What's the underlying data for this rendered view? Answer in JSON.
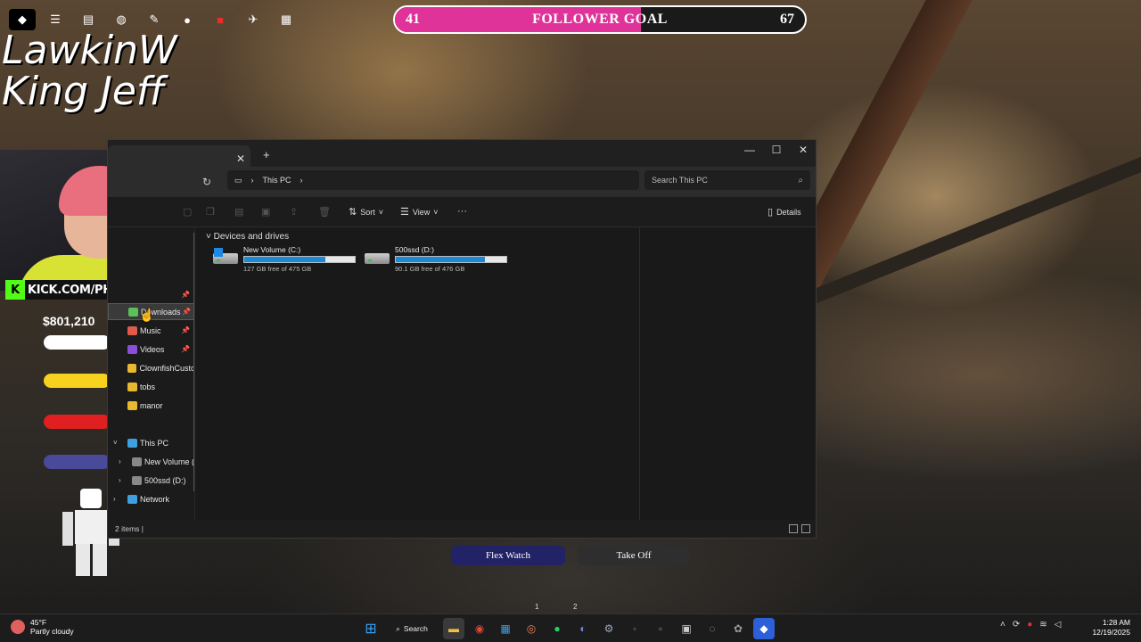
{
  "overlay": {
    "top_icons": [
      {
        "icon": "kick-icon",
        "glyph": "◆"
      },
      {
        "icon": "menu-icon",
        "glyph": "☰"
      },
      {
        "icon": "chat-icon",
        "glyph": "▤"
      },
      {
        "icon": "globe-icon",
        "glyph": "◍"
      },
      {
        "icon": "user-edit-icon",
        "glyph": "✎"
      },
      {
        "icon": "user-icon",
        "glyph": "●"
      },
      {
        "icon": "stop-icon",
        "glyph": "■"
      },
      {
        "icon": "runner-icon",
        "glyph": "✈"
      },
      {
        "icon": "grid-icon",
        "glyph": "▦"
      }
    ],
    "goal": {
      "start": "41",
      "title": "FOLLOWER GOAL",
      "end": "67",
      "progress": 0.6
    },
    "names": [
      "LawkinW",
      "King Jeff"
    ],
    "kick_label": "KICK.COM/PHROPHET",
    "money": "$801,210",
    "stat_bars": [
      {
        "color": "#ffffff"
      },
      {
        "color": "#f6d21e"
      },
      {
        "color": "#e02020"
      },
      {
        "color": "#4a4a9a"
      }
    ]
  },
  "explorer": {
    "address": {
      "segments": [
        "This PC"
      ]
    },
    "search_placeholder": "Search This PC",
    "toolbar": {
      "sort": "Sort",
      "view": "View",
      "more": "···",
      "details": "Details"
    },
    "nav": [
      {
        "label": "Downloads",
        "icon_color": "#5ac05a",
        "pinned": true,
        "selected": true
      },
      {
        "label": "Music",
        "icon_color": "#e05a4e",
        "pinned": true
      },
      {
        "label": "Videos",
        "icon_color": "#8a4ed8",
        "pinned": true
      },
      {
        "label": "ClownfishCusto",
        "icon_color": "#e8b830"
      },
      {
        "label": "tobs",
        "icon_color": "#e8b830"
      },
      {
        "label": "manor",
        "icon_color": "#e8b830"
      }
    ],
    "tree": {
      "this_pc": "This PC",
      "children": [
        "New Volume (",
        "500ssd (D:)"
      ],
      "network": "Network"
    },
    "section_title": "Devices and drives",
    "drives": [
      {
        "name": "New Volume (C:)",
        "free": "127 GB free of 475 GB",
        "used_fraction": 0.73,
        "windows": true
      },
      {
        "name": "500ssd (D:)",
        "free": "90.1 GB free of 476 GB",
        "used_fraction": 0.81,
        "windows": false
      }
    ],
    "status": "2 items  |"
  },
  "game": {
    "buttons": [
      {
        "label": "Flex Watch",
        "bg": "#222266"
      },
      {
        "label": "Take Off",
        "bg": "#2e2e2e"
      }
    ],
    "hotkeys": [
      "1",
      "2"
    ]
  },
  "taskbar": {
    "weather_temp": "45°F",
    "weather_desc": "Partly cloudy",
    "search_label": "Search",
    "time": "1:28 AM",
    "date": "12/19/2025"
  }
}
